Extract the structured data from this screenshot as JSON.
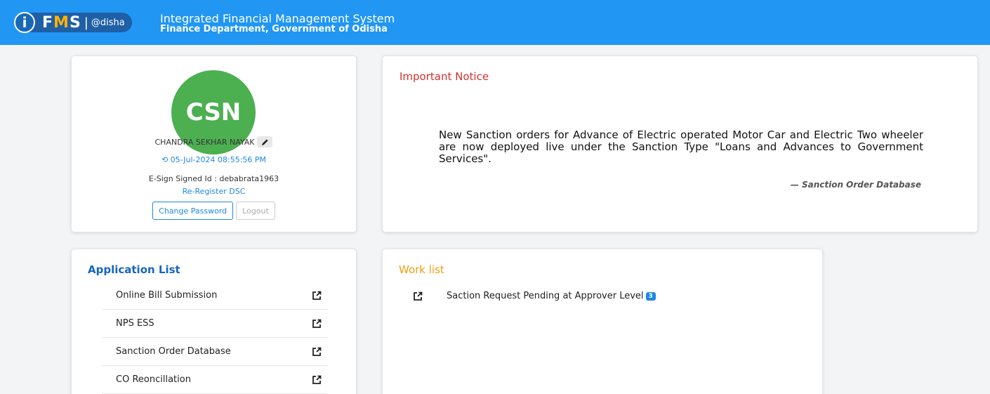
{
  "header": {
    "logo_i": "i",
    "logo_f": "F",
    "logo_m": "M",
    "logo_s": "S",
    "logo_sep": "|",
    "logo_odisha": "@disha",
    "title": "Integrated Financial Management System",
    "subtitle": "Finance Department, Government of Odisha",
    "bg_color": "#2196f3"
  },
  "profile": {
    "initials": "CSN",
    "avatar_color": "#4caf50",
    "name": "CHANDRA SEKHAR NAYAK",
    "edit_icon": "pencil-icon",
    "login_time": "05-Jul-2024 08:55:56 PM",
    "history_icon": "history-icon",
    "esign": "E-Sign Signed Id : debabrata1963",
    "re_register": "Re-Register DSC",
    "change_password": "Change Password",
    "logout": "Logout"
  },
  "notice": {
    "title": "Important Notice",
    "body": "New Sanction orders for Advance of Electric operated Motor Car and Electric Two wheeler are now deployed live under the Sanction Type \"Loans and Advances to Government Services\".",
    "cite": "— Sanction Order Database"
  },
  "applist": {
    "title": "Application List",
    "items": [
      {
        "label": "Online Bill Submission",
        "icon": "external-link-icon"
      },
      {
        "label": "NPS ESS",
        "icon": "external-link-icon"
      },
      {
        "label": "Sanction Order Database",
        "icon": "external-link-icon"
      },
      {
        "label": "CO Reoncillation",
        "icon": "external-link-icon"
      }
    ]
  },
  "worklist": {
    "title": "Work list",
    "items": [
      {
        "label": "Saction Request Pending at Approver Level",
        "count": "3",
        "icon": "external-link-icon"
      }
    ]
  }
}
